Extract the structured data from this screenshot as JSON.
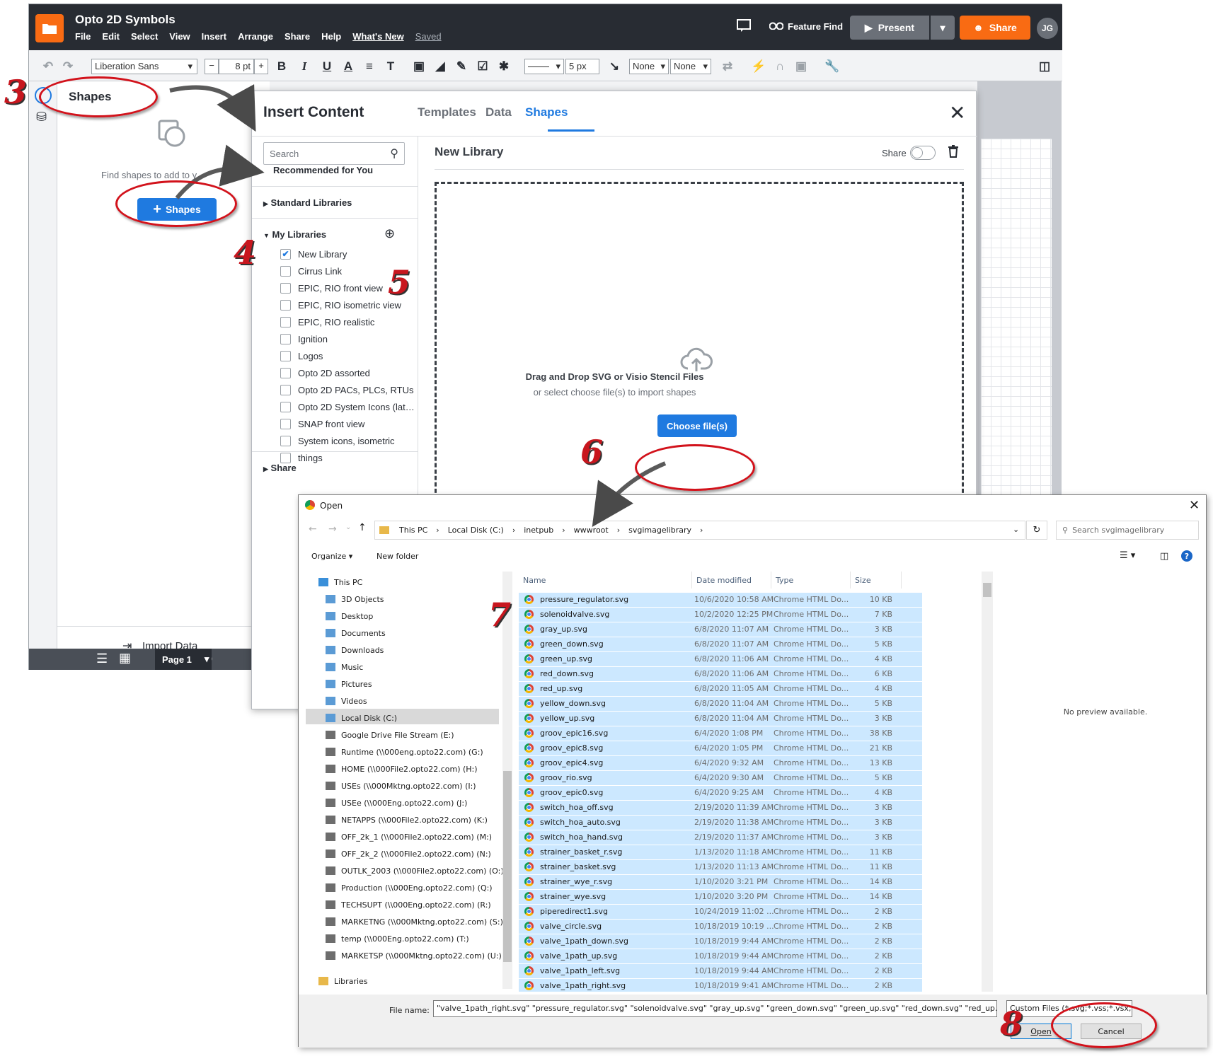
{
  "app": {
    "title": "Opto 2D Symbols",
    "menu": [
      "File",
      "Edit",
      "Select",
      "View",
      "Insert",
      "Arrange",
      "Share",
      "Help"
    ],
    "whats_new": "What's New",
    "saved": "Saved",
    "feature_find": "Feature Find",
    "present": "Present",
    "share": "Share",
    "avatar": "JG",
    "accent": "#1f7ae0",
    "brand": "#f96b13"
  },
  "toolbar": {
    "font": "Liberation Sans",
    "font_size": "8 pt",
    "line_width": "5 px",
    "start_arrow": "None",
    "end_arrow": "None"
  },
  "shapes_panel": {
    "title": "Shapes",
    "find_text": "Find shapes to add to y",
    "add_button": "Shapes",
    "import_data": "Import Data",
    "page_tab": "Page 1"
  },
  "insert_dialog": {
    "title": "Insert Content",
    "tabs": [
      "Templates",
      "Data",
      "Shapes"
    ],
    "search_placeholder": "Search",
    "recommended": "Recommended for You",
    "standard_libraries": "Standard Libraries",
    "my_libraries": "My Libraries",
    "shared": "Share",
    "libraries": [
      {
        "name": "New Library",
        "checked": true
      },
      {
        "name": "Cirrus Link",
        "checked": false
      },
      {
        "name": "EPIC, RIO front view",
        "checked": false
      },
      {
        "name": "EPIC, RIO isometric view",
        "checked": false
      },
      {
        "name": "EPIC, RIO realistic",
        "checked": false
      },
      {
        "name": "Ignition",
        "checked": false
      },
      {
        "name": "Logos",
        "checked": false
      },
      {
        "name": "Opto 2D assorted",
        "checked": false
      },
      {
        "name": "Opto 2D PACs, PLCs, RTUs",
        "checked": false
      },
      {
        "name": "Opto 2D System Icons (lat…",
        "checked": false
      },
      {
        "name": "SNAP front view",
        "checked": false
      },
      {
        "name": "System icons, isometric",
        "checked": false
      },
      {
        "name": "things",
        "checked": false
      }
    ],
    "library_title": "New Library",
    "share_label": "Share",
    "drop_title": "Drag and Drop SVG or Visio Stencil Files",
    "drop_sub": "or select choose file(s) to import shapes",
    "choose_button": "Choose file(s)"
  },
  "open_dialog": {
    "title": "Open",
    "path": [
      "This PC",
      "Local Disk (C:)",
      "inetpub",
      "wwwroot",
      "svgimagelibrary"
    ],
    "search_placeholder": "Search svgimagelibrary",
    "organize": "Organize",
    "new_folder": "New folder",
    "nav": [
      {
        "label": "This PC",
        "indent": 0
      },
      {
        "label": "3D Objects",
        "indent": 1
      },
      {
        "label": "Desktop",
        "indent": 1
      },
      {
        "label": "Documents",
        "indent": 1
      },
      {
        "label": "Downloads",
        "indent": 1
      },
      {
        "label": "Music",
        "indent": 1
      },
      {
        "label": "Pictures",
        "indent": 1
      },
      {
        "label": "Videos",
        "indent": 1
      },
      {
        "label": "Local Disk (C:)",
        "indent": 1
      },
      {
        "label": "Google Drive File Stream (E:)",
        "indent": 1
      },
      {
        "label": "Runtime (\\\\000eng.opto22.com) (G:)",
        "indent": 1
      },
      {
        "label": "HOME (\\\\000File2.opto22.com) (H:)",
        "indent": 1
      },
      {
        "label": "USEs (\\\\000Mktng.opto22.com) (I:)",
        "indent": 1
      },
      {
        "label": "USEe (\\\\000Eng.opto22.com) (J:)",
        "indent": 1
      },
      {
        "label": "NETAPPS (\\\\000File2.opto22.com) (K:)",
        "indent": 1
      },
      {
        "label": "OFF_2k_1 (\\\\000File2.opto22.com) (M:)",
        "indent": 1
      },
      {
        "label": "OFF_2k_2 (\\\\000File2.opto22.com) (N:)",
        "indent": 1
      },
      {
        "label": "OUTLK_2003 (\\\\000File2.opto22.com) (O:)",
        "indent": 1
      },
      {
        "label": "Production (\\\\000Eng.opto22.com) (Q:)",
        "indent": 1
      },
      {
        "label": "TECHSUPT (\\\\000Eng.opto22.com) (R:)",
        "indent": 1
      },
      {
        "label": "MARKETNG (\\\\000Mktng.opto22.com) (S:)",
        "indent": 1
      },
      {
        "label": "temp (\\\\000Eng.opto22.com) (T:)",
        "indent": 1
      },
      {
        "label": "MARKETSP (\\\\000Mktng.opto22.com) (U:)",
        "indent": 1
      },
      {
        "label": "Libraries",
        "indent": 0
      }
    ],
    "columns": [
      "Name",
      "Date modified",
      "Type",
      "Size"
    ],
    "files": [
      [
        "pressure_regulator.svg",
        "10/6/2020 10:58 AM",
        "Chrome HTML Do...",
        "10 KB"
      ],
      [
        "solenoidvalve.svg",
        "10/2/2020 12:25 PM",
        "Chrome HTML Do...",
        "7 KB"
      ],
      [
        "gray_up.svg",
        "6/8/2020 11:07 AM",
        "Chrome HTML Do...",
        "3 KB"
      ],
      [
        "green_down.svg",
        "6/8/2020 11:07 AM",
        "Chrome HTML Do...",
        "5 KB"
      ],
      [
        "green_up.svg",
        "6/8/2020 11:06 AM",
        "Chrome HTML Do...",
        "4 KB"
      ],
      [
        "red_down.svg",
        "6/8/2020 11:06 AM",
        "Chrome HTML Do...",
        "6 KB"
      ],
      [
        "red_up.svg",
        "6/8/2020 11:05 AM",
        "Chrome HTML Do...",
        "4 KB"
      ],
      [
        "yellow_down.svg",
        "6/8/2020 11:04 AM",
        "Chrome HTML Do...",
        "5 KB"
      ],
      [
        "yellow_up.svg",
        "6/8/2020 11:04 AM",
        "Chrome HTML Do...",
        "3 KB"
      ],
      [
        "groov_epic16.svg",
        "6/4/2020 1:08 PM",
        "Chrome HTML Do...",
        "38 KB"
      ],
      [
        "groov_epic8.svg",
        "6/4/2020 1:05 PM",
        "Chrome HTML Do...",
        "21 KB"
      ],
      [
        "groov_epic4.svg",
        "6/4/2020 9:32 AM",
        "Chrome HTML Do...",
        "13 KB"
      ],
      [
        "groov_rio.svg",
        "6/4/2020 9:30 AM",
        "Chrome HTML Do...",
        "5 KB"
      ],
      [
        "groov_epic0.svg",
        "6/4/2020 9:25 AM",
        "Chrome HTML Do...",
        "4 KB"
      ],
      [
        "switch_hoa_off.svg",
        "2/19/2020 11:39 AM",
        "Chrome HTML Do...",
        "3 KB"
      ],
      [
        "switch_hoa_auto.svg",
        "2/19/2020 11:38 AM",
        "Chrome HTML Do...",
        "3 KB"
      ],
      [
        "switch_hoa_hand.svg",
        "2/19/2020 11:37 AM",
        "Chrome HTML Do...",
        "3 KB"
      ],
      [
        "strainer_basket_r.svg",
        "1/13/2020 11:18 AM",
        "Chrome HTML Do...",
        "11 KB"
      ],
      [
        "strainer_basket.svg",
        "1/13/2020 11:13 AM",
        "Chrome HTML Do...",
        "11 KB"
      ],
      [
        "strainer_wye_r.svg",
        "1/10/2020 3:21 PM",
        "Chrome HTML Do...",
        "14 KB"
      ],
      [
        "strainer_wye.svg",
        "1/10/2020 3:20 PM",
        "Chrome HTML Do...",
        "14 KB"
      ],
      [
        "piperedirect1.svg",
        "10/24/2019 11:02 ...",
        "Chrome HTML Do...",
        "2 KB"
      ],
      [
        "valve_circle.svg",
        "10/18/2019 10:19 ...",
        "Chrome HTML Do...",
        "2 KB"
      ],
      [
        "valve_1path_down.svg",
        "10/18/2019 9:44 AM",
        "Chrome HTML Do...",
        "2 KB"
      ],
      [
        "valve_1path_up.svg",
        "10/18/2019 9:44 AM",
        "Chrome HTML Do...",
        "2 KB"
      ],
      [
        "valve_1path_left.svg",
        "10/18/2019 9:44 AM",
        "Chrome HTML Do...",
        "2 KB"
      ],
      [
        "valve_1path_right.svg",
        "10/18/2019 9:41 AM",
        "Chrome HTML Do...",
        "2 KB"
      ]
    ],
    "preview": "No preview available.",
    "file_name_label": "File name:",
    "file_name_value": "\"valve_1path_right.svg\" \"pressure_regulator.svg\" \"solenoidvalve.svg\" \"gray_up.svg\" \"green_down.svg\" \"green_up.svg\" \"red_down.svg\" \"red_up.svg\" \"yellow_down",
    "filter": "Custom Files (*.svg;*.vss;*.vsx;*",
    "open_button": "Open",
    "cancel_button": "Cancel"
  },
  "annotations": [
    "3",
    "4",
    "5",
    "6",
    "7",
    "8"
  ]
}
